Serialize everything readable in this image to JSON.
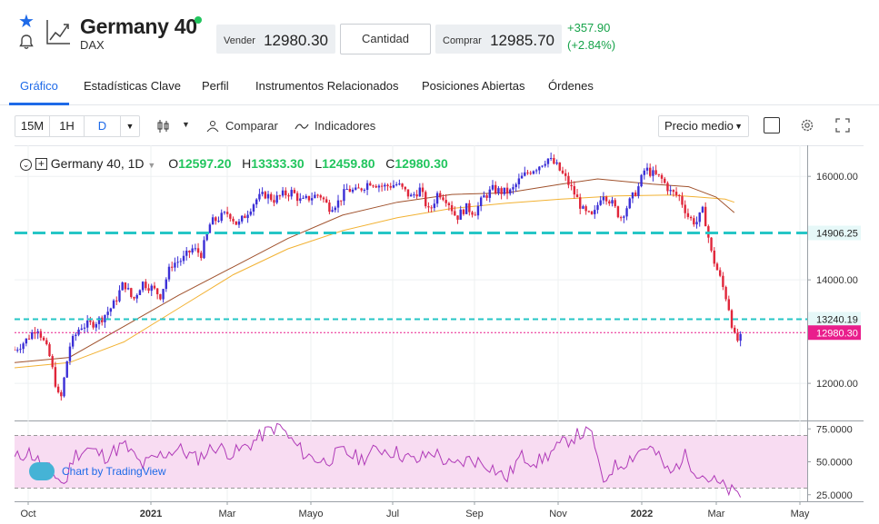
{
  "header": {
    "title": "Germany 40",
    "subtitle": "DAX",
    "sell_label": "Vender",
    "sell_value": "12980.30",
    "quantity_label": "Cantidad",
    "buy_label": "Comprar",
    "buy_value": "12985.70",
    "change_abs": "+357.90",
    "change_pct": "(+2.84%)"
  },
  "tabs": [
    "Gráfico",
    "Estadísticas Clave",
    "Perfil",
    "Instrumentos Relacionados",
    "Posiciones Abiertas",
    "Órdenes"
  ],
  "active_tab": "Gráfico",
  "toolbar": {
    "tf_15m": "15M",
    "tf_1h": "1H",
    "tf_d": "D",
    "compare": "Comparar",
    "indicators": "Indicadores",
    "price_mode": "Precio medio"
  },
  "legend": {
    "symbol": "Germany 40, 1D",
    "o_label": "O",
    "o_value": "12597.20",
    "h_label": "H",
    "h_value": "13333.30",
    "l_label": "L",
    "l_value": "12459.80",
    "c_label": "C",
    "c_value": "12980.30"
  },
  "watermark": "Chart by TradingView",
  "colors": {
    "accent": "#1e6ae8",
    "up": "#3b2fd6",
    "down": "#e0263a",
    "positive": "#16a34a",
    "level": "#26c6c6",
    "last_price": "#e91e8c",
    "rsi": "#b03ab8"
  },
  "chart_data": {
    "type": "candlestick",
    "price_axis_ticks": [
      16000,
      14000,
      12000
    ],
    "price_axis_labels": [
      "16000.00",
      "14000.00",
      "12000.00"
    ],
    "price_ylim": [
      11300,
      16600
    ],
    "horizontal_levels": [
      {
        "value": 14906.25,
        "label": "14906.25"
      },
      {
        "value": 13240.19,
        "label": "13240.19"
      }
    ],
    "last_price": {
      "value": 12980.3,
      "label": "12980.30"
    },
    "x_ticks": [
      "Oct",
      "2021",
      "Mar",
      "Mayo",
      "Jul",
      "Sep",
      "Nov",
      "2022",
      "Mar",
      "May"
    ],
    "x_ticks_bold": [
      "2021",
      "2022"
    ],
    "close_path": {
      "points": [
        [
          0,
          12650
        ],
        [
          12,
          12820
        ],
        [
          25,
          13100
        ],
        [
          38,
          12550
        ],
        [
          50,
          11600
        ],
        [
          60,
          12700
        ],
        [
          72,
          13100
        ],
        [
          85,
          13150
        ],
        [
          95,
          13250
        ],
        [
          108,
          13500
        ],
        [
          120,
          13950
        ],
        [
          130,
          13600
        ],
        [
          140,
          13950
        ],
        [
          150,
          13850
        ],
        [
          160,
          13700
        ],
        [
          172,
          14300
        ],
        [
          185,
          14400
        ],
        [
          195,
          14600
        ],
        [
          205,
          14500
        ],
        [
          215,
          15100
        ],
        [
          225,
          15200
        ],
        [
          235,
          15300
        ],
        [
          245,
          15050
        ],
        [
          255,
          15300
        ],
        [
          265,
          15550
        ],
        [
          275,
          15650
        ],
        [
          285,
          15550
        ],
        [
          295,
          15650
        ],
        [
          305,
          15700
        ],
        [
          315,
          15500
        ],
        [
          325,
          15600
        ],
        [
          335,
          15650
        ],
        [
          345,
          15400
        ],
        [
          355,
          15500
        ],
        [
          365,
          15750
        ],
        [
          375,
          15700
        ],
        [
          390,
          15900
        ],
        [
          405,
          15800
        ],
        [
          420,
          15850
        ],
        [
          435,
          15600
        ],
        [
          445,
          15750
        ],
        [
          455,
          15300
        ],
        [
          465,
          15700
        ],
        [
          475,
          15550
        ],
        [
          485,
          15200
        ],
        [
          495,
          15400
        ],
        [
          505,
          15300
        ],
        [
          515,
          15600
        ],
        [
          525,
          15750
        ],
        [
          535,
          15700
        ],
        [
          545,
          15700
        ],
        [
          555,
          15950
        ],
        [
          565,
          16100
        ],
        [
          575,
          16200
        ],
        [
          585,
          16350
        ],
        [
          595,
          16200
        ],
        [
          605,
          15950
        ],
        [
          615,
          15650
        ],
        [
          625,
          15300
        ],
        [
          635,
          15200
        ],
        [
          645,
          15700
        ],
        [
          655,
          15500
        ],
        [
          665,
          15200
        ],
        [
          675,
          15500
        ],
        [
          685,
          15800
        ],
        [
          692,
          16150
        ],
        [
          700,
          16050
        ],
        [
          710,
          15950
        ],
        [
          720,
          15700
        ],
        [
          730,
          15600
        ],
        [
          740,
          15200
        ],
        [
          748,
          15100
        ],
        [
          756,
          15350
        ],
        [
          765,
          14500
        ],
        [
          775,
          14000
        ],
        [
          783,
          13550
        ],
        [
          790,
          12900
        ],
        [
          795,
          12800
        ],
        [
          800,
          12980
        ]
      ],
      "x_range": [
        0,
        870
      ]
    },
    "ma200": [
      [
        0,
        12300
      ],
      [
        60,
        12400
      ],
      [
        120,
        12800
      ],
      [
        180,
        13450
      ],
      [
        240,
        14100
      ],
      [
        300,
        14600
      ],
      [
        360,
        14950
      ],
      [
        420,
        15200
      ],
      [
        480,
        15380
      ],
      [
        540,
        15480
      ],
      [
        600,
        15560
      ],
      [
        660,
        15620
      ],
      [
        720,
        15640
      ],
      [
        780,
        15560
      ],
      [
        790,
        15500
      ]
    ],
    "ma50": [
      [
        0,
        12400
      ],
      [
        60,
        12500
      ],
      [
        120,
        13100
      ],
      [
        180,
        13700
      ],
      [
        240,
        14250
      ],
      [
        300,
        14800
      ],
      [
        360,
        15250
      ],
      [
        420,
        15500
      ],
      [
        480,
        15650
      ],
      [
        540,
        15680
      ],
      [
        600,
        15850
      ],
      [
        640,
        15950
      ],
      [
        700,
        15850
      ],
      [
        740,
        15800
      ],
      [
        770,
        15600
      ],
      [
        790,
        15300
      ]
    ],
    "rsi": {
      "axis_ticks": [
        75,
        50,
        25
      ],
      "axis_labels": [
        "75.0000",
        "50.0000",
        "25.0000"
      ],
      "band": [
        30,
        70
      ],
      "ylim": [
        20,
        80
      ],
      "values": [
        [
          0,
          52
        ],
        [
          15,
          58
        ],
        [
          30,
          48
        ],
        [
          45,
          40
        ],
        [
          55,
          32
        ],
        [
          65,
          55
        ],
        [
          80,
          60
        ],
        [
          100,
          54
        ],
        [
          120,
          63
        ],
        [
          140,
          47
        ],
        [
          160,
          55
        ],
        [
          180,
          60
        ],
        [
          200,
          52
        ],
        [
          220,
          62
        ],
        [
          240,
          56
        ],
        [
          260,
          64
        ],
        [
          275,
          72
        ],
        [
          290,
          78
        ],
        [
          305,
          65
        ],
        [
          320,
          55
        ],
        [
          340,
          50
        ],
        [
          360,
          58
        ],
        [
          380,
          52
        ],
        [
          400,
          60
        ],
        [
          420,
          57
        ],
        [
          440,
          50
        ],
        [
          460,
          58
        ],
        [
          480,
          46
        ],
        [
          500,
          52
        ],
        [
          520,
          48
        ],
        [
          540,
          37
        ],
        [
          555,
          54
        ],
        [
          575,
          50
        ],
        [
          595,
          60
        ],
        [
          610,
          68
        ],
        [
          625,
          72
        ],
        [
          635,
          70
        ],
        [
          645,
          32
        ],
        [
          655,
          45
        ],
        [
          670,
          50
        ],
        [
          685,
          58
        ],
        [
          695,
          62
        ],
        [
          705,
          55
        ],
        [
          720,
          40
        ],
        [
          735,
          55
        ],
        [
          750,
          42
        ],
        [
          765,
          36
        ],
        [
          780,
          30
        ],
        [
          790,
          26
        ],
        [
          795,
          24
        ],
        [
          800,
          26
        ]
      ]
    }
  }
}
